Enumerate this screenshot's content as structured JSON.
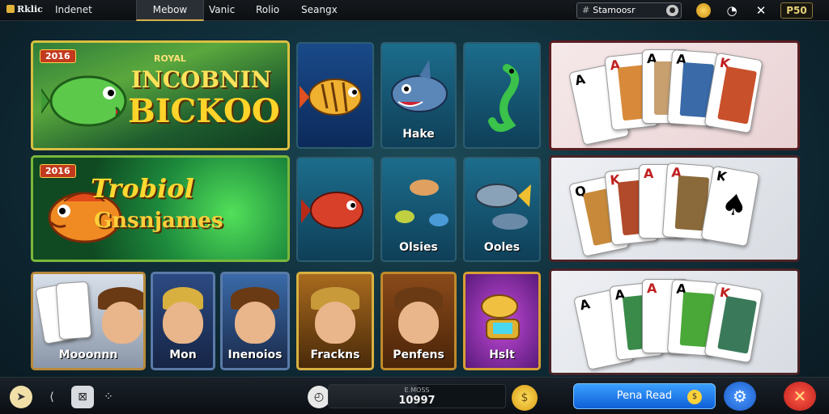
{
  "app": {
    "logo": "Rklic",
    "title": "Indenet"
  },
  "tabs": [
    {
      "label": "Mebow",
      "active": true
    },
    {
      "label": "Vanic",
      "active": false
    },
    {
      "label": "Rolio",
      "active": false
    },
    {
      "label": "Seangx",
      "active": false
    }
  ],
  "search": {
    "hash": "#",
    "value": "Stamoosr"
  },
  "header": {
    "balance": "P50"
  },
  "banners": [
    {
      "chip": "2016",
      "small": "ROYAL",
      "line1": "INCOBNIN",
      "line2": "BICKOO"
    },
    {
      "chip": "2016",
      "line1": "Trobiol",
      "line2": "Gnsnjames"
    }
  ],
  "ocean_tiles": [
    {
      "label": ""
    },
    {
      "label": "Hake"
    },
    {
      "label": ""
    },
    {
      "label": ""
    },
    {
      "label": "Olsies"
    },
    {
      "label": "Ooles"
    }
  ],
  "card_panels": [
    {
      "cards": [
        "A",
        "A",
        "A",
        "A",
        "K"
      ]
    },
    {
      "cards": [
        "Q",
        "K",
        "A",
        "A",
        "K"
      ]
    },
    {
      "cards": [
        "A",
        "A",
        "A",
        "A",
        "K"
      ]
    }
  ],
  "game_tiles": [
    {
      "label": "Mooonnn"
    },
    {
      "label": "Mon"
    },
    {
      "label": "Inenoios"
    },
    {
      "label": "Frackns"
    },
    {
      "label": "Penfens"
    },
    {
      "label": "Hslt"
    }
  ],
  "bottom": {
    "progress_caption": "E.MOSS",
    "progress_value": "10997",
    "progress_fraction": 0.5,
    "play_label": "Pena Read"
  },
  "colors": {
    "accent": "#d9b24b",
    "play": "#1f7ae8",
    "close": "#e0302a",
    "settings": "#2a6fd8"
  }
}
